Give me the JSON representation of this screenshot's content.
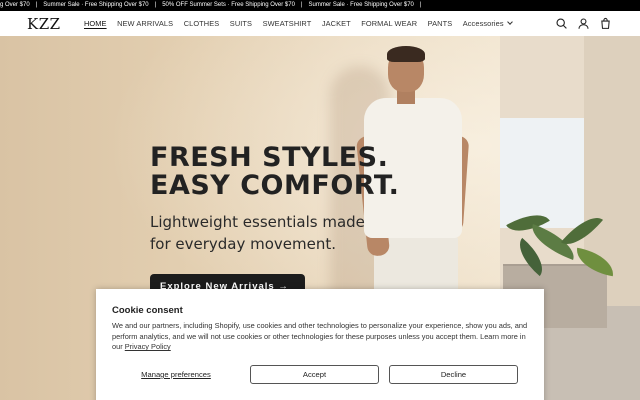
{
  "announcement": {
    "items": [
      "g Over $70",
      "Summer Sale · Free Shipping Over $70",
      "50% OFF Summer Sets · Free Shipping Over $70",
      "Summer Sale · Free Shipping Over $70"
    ],
    "separator": "|"
  },
  "header": {
    "logo": "KZZ",
    "nav": [
      {
        "label": "HOME",
        "active": true
      },
      {
        "label": "NEW ARRIVALS"
      },
      {
        "label": "CLOTHES"
      },
      {
        "label": "SUITS"
      },
      {
        "label": "SWEATSHIRT"
      },
      {
        "label": "JACKET"
      },
      {
        "label": "FORMAL WEAR"
      },
      {
        "label": "PANTS"
      },
      {
        "label": "Accessories"
      }
    ],
    "icons": [
      "search-icon",
      "account-icon",
      "cart-icon"
    ]
  },
  "hero": {
    "title_line1": "FRESH STYLES.",
    "title_line2": "EASY COMFORT.",
    "subtitle_line1": "Lightweight essentials made",
    "subtitle_line2": "for everyday movement.",
    "cta_label": "Explore New Arrivals →"
  },
  "cookie": {
    "title": "Cookie consent",
    "text": "We and our partners, including Shopify, use cookies and other technologies to personalize your experience, show you ads, and perform analytics, and we will not use cookies or other technologies for these purposes unless you accept them. Learn more in our ",
    "policy_link": "Privacy Policy",
    "manage_label": "Manage preferences",
    "accept_label": "Accept",
    "decline_label": "Decline"
  },
  "colors": {
    "announcement_bg": "#000000",
    "cta_bg": "#1c1c1c",
    "text_dark": "#222222"
  }
}
